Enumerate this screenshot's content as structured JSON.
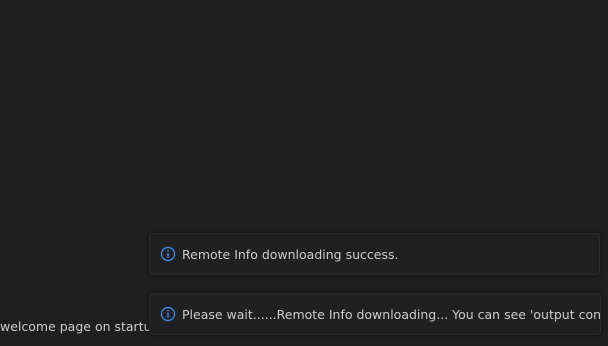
{
  "background": {
    "welcome_text": "welcome page on startup"
  },
  "notifications": [
    {
      "icon": "info-icon",
      "message": "Remote Info downloading success."
    },
    {
      "icon": "info-icon",
      "message": "Please wait......Remote Info downloading... You can see 'output console'"
    }
  ],
  "colors": {
    "background": "#1f1f1f",
    "toast_background": "#202020",
    "text": "#cccccc",
    "info_accent": "#3794ff"
  }
}
